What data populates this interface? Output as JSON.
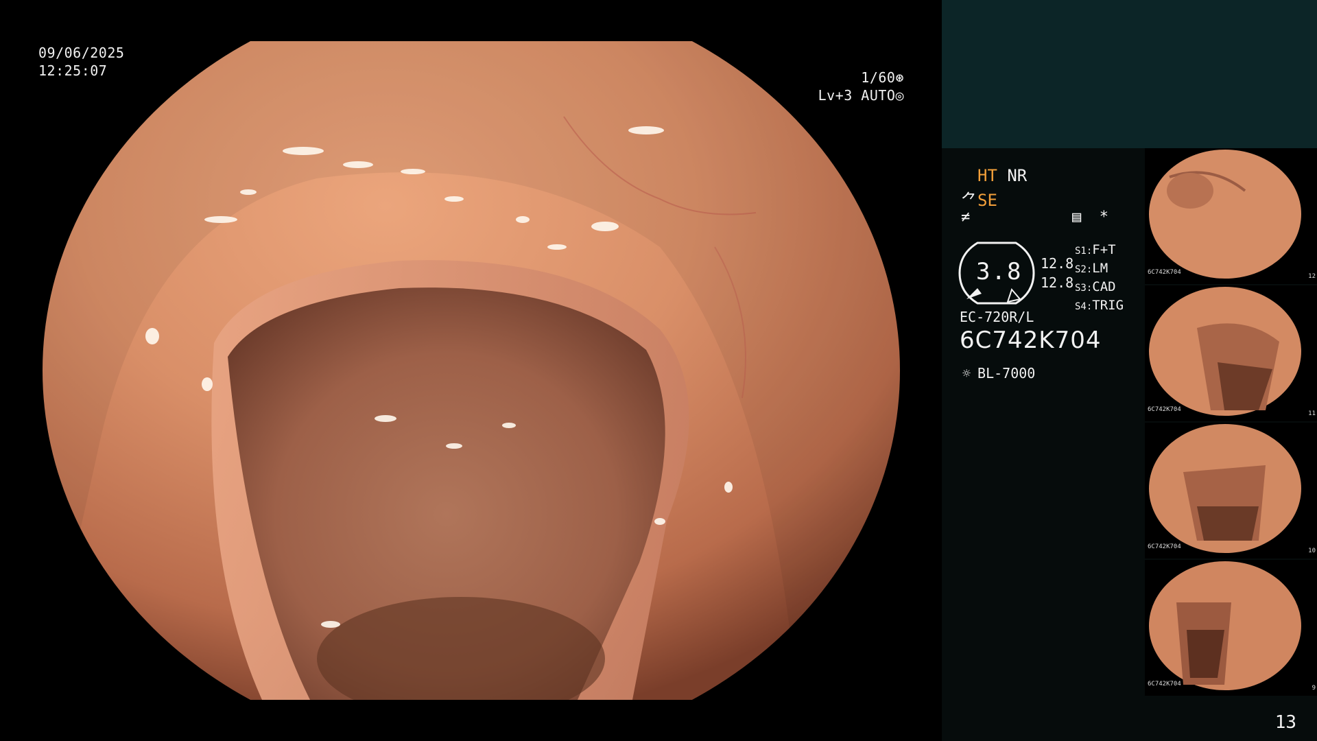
{
  "overlay": {
    "date": "09/06/2025",
    "time": "12:25:07",
    "shutter": "1/60",
    "level": "Lv+3 AUTO"
  },
  "panel": {
    "ht": "HT",
    "nr": "NR",
    "se": "SE",
    "gauge_value": "3.8",
    "gauge_num_1": "12.8",
    "gauge_num_2": "12.8",
    "switches": [
      {
        "key": "S1",
        "value": "F+T"
      },
      {
        "key": "S2",
        "value": "LM"
      },
      {
        "key": "S3",
        "value": "CAD"
      },
      {
        "key": "S4",
        "value": "TRIG"
      }
    ],
    "scope_model": "EC-720R/L",
    "scope_serial": "6C742K704",
    "light_source": "BL-7000",
    "page_number": "13"
  },
  "thumbnails": [
    {
      "label": "6C742K704",
      "number": "12"
    },
    {
      "label": "6C742K704",
      "number": "11"
    },
    {
      "label": "6C742K704",
      "number": "10"
    },
    {
      "label": "6C742K704",
      "number": "9"
    }
  ],
  "colors": {
    "panel_top": "#0c2527",
    "panel_bg": "#060c0c",
    "accent_orange": "#f3a03a",
    "mucosa": "#d98f68"
  },
  "icons": [
    "aperture-icon",
    "auto-iris-icon",
    "structure-enhance-icon",
    "enhance-icon",
    "record-icon",
    "asterisk-icon",
    "light-source-icon"
  ]
}
